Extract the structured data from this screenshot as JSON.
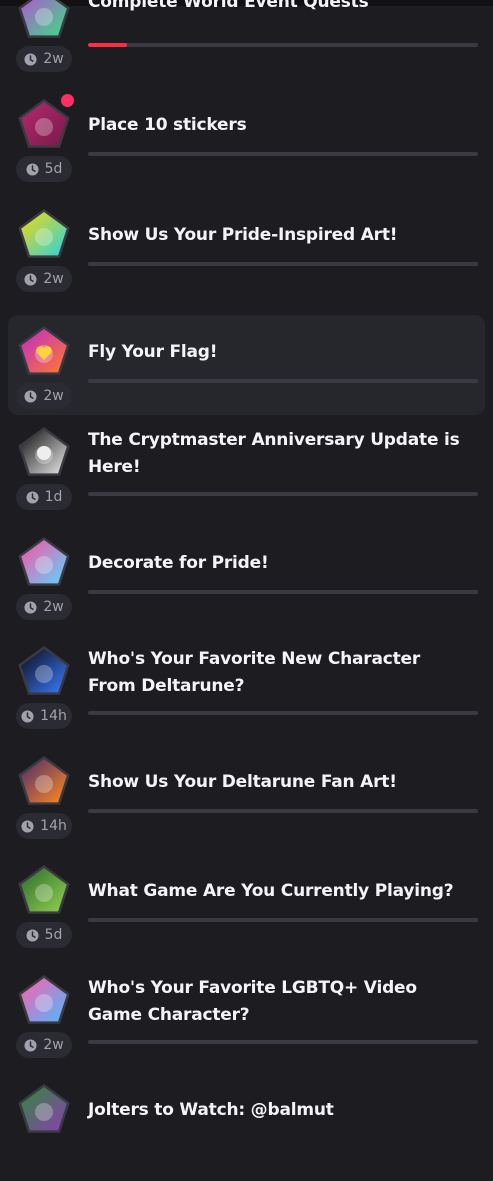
{
  "colors": {
    "background": "#1c1c21",
    "highlight_row": "#26262d",
    "progress_track": "#3a3a43",
    "progress_fill": "#ff2d3d",
    "notification_dot": "#ff2e63"
  },
  "quests": [
    {
      "title": "Complete World Event Quests",
      "time": "2w",
      "progress": 0.1,
      "badge_icon": "world-event-badge-icon",
      "badge_colors": [
        "#b64fd6",
        "#3ddc84"
      ],
      "highlighted": false,
      "notification": false
    },
    {
      "title": "Place 10 stickers",
      "time": "5d",
      "progress": 0,
      "badge_icon": "stickers-badge-icon",
      "badge_colors": [
        "#b22a6e",
        "#7a1a4a"
      ],
      "highlighted": false,
      "notification": true
    },
    {
      "title": "Show Us Your Pride-Inspired Art!",
      "time": "2w",
      "progress": 0,
      "badge_icon": "pride-art-badge-icon",
      "badge_colors": [
        "#f5d90a",
        "#2dd1e0"
      ],
      "highlighted": false,
      "notification": false
    },
    {
      "title": "Fly Your Flag!",
      "time": "2w",
      "progress": 0,
      "badge_icon": "pride-flag-heart-badge-icon",
      "badge_colors": [
        "#c02ac7",
        "#ff7a30"
      ],
      "highlighted": true,
      "notification": false
    },
    {
      "title": "The Cryptmaster Anniversary Update is Here!",
      "time": "1d",
      "progress": 0,
      "badge_icon": "cryptmaster-skull-badge-icon",
      "badge_colors": [
        "#111111",
        "#e8e8e8"
      ],
      "highlighted": false,
      "notification": false
    },
    {
      "title": "Decorate for Pride!",
      "time": "2w",
      "progress": 0,
      "badge_icon": "decorate-pride-badge-icon",
      "badge_colors": [
        "#ff4fa0",
        "#5ad6ff"
      ],
      "highlighted": false,
      "notification": false
    },
    {
      "title": "Who's Your Favorite New Character From Deltarune?",
      "time": "14h",
      "progress": 0,
      "badge_icon": "deltarune-character-badge-icon",
      "badge_colors": [
        "#0c0c14",
        "#3b7bff"
      ],
      "highlighted": false,
      "notification": false
    },
    {
      "title": "Show Us Your Deltarune Fan Art!",
      "time": "14h",
      "progress": 0,
      "badge_icon": "deltarune-fan-art-badge-icon",
      "badge_colors": [
        "#4a2a6e",
        "#ff8a1f"
      ],
      "highlighted": false,
      "notification": false
    },
    {
      "title": "What Game Are You Currently Playing?",
      "time": "5d",
      "progress": 0,
      "badge_icon": "currently-playing-badge-icon",
      "badge_colors": [
        "#2e6b2e",
        "#8fd14f"
      ],
      "highlighted": false,
      "notification": false
    },
    {
      "title": "Who's Your Favorite LGBTQ+ Video Game Character?",
      "time": "2w",
      "progress": 0,
      "badge_icon": "lgbtq-character-badge-icon",
      "badge_colors": [
        "#ff5fa8",
        "#4fb8ff"
      ],
      "highlighted": false,
      "notification": false
    },
    {
      "title": "Jolters to Watch: @balmut",
      "time": "",
      "progress": 0,
      "badge_icon": "jolters-to-watch-badge-icon",
      "badge_colors": [
        "#2f8a3a",
        "#8b3fb0"
      ],
      "highlighted": false,
      "notification": false
    }
  ]
}
